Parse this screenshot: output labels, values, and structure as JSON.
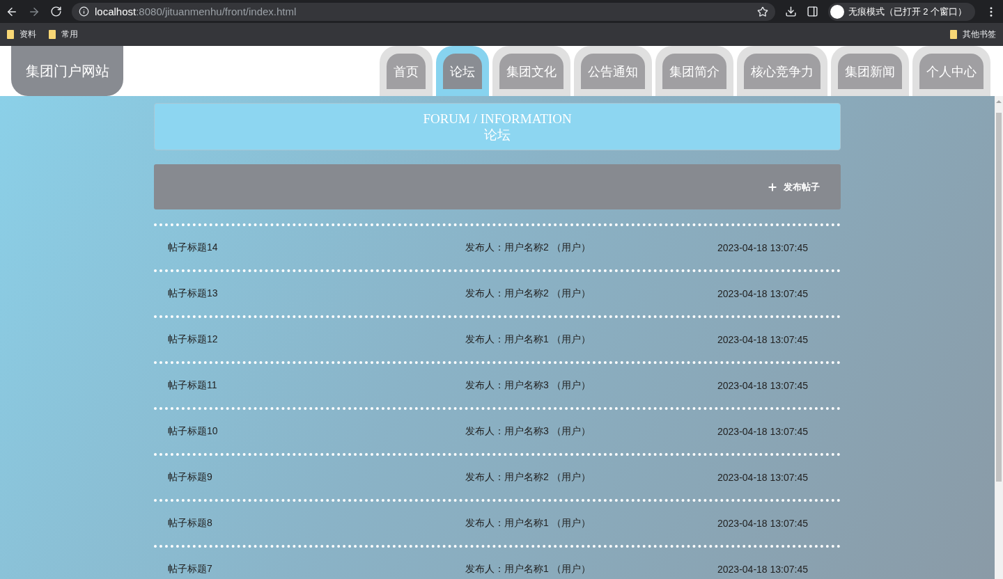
{
  "browser": {
    "url_host": "localhost",
    "url_path": ":8080/jituanmenhu/front/index.html",
    "profile": "无痕模式（已打开 2 个窗口）",
    "bookmarks": [
      "资料",
      "常用"
    ],
    "other_bookmarks": "其他书签"
  },
  "site": {
    "title": "集团门户网站"
  },
  "nav": [
    {
      "label": "首页",
      "selected": false
    },
    {
      "label": "论坛",
      "selected": true
    },
    {
      "label": "集团文化",
      "selected": false
    },
    {
      "label": "公告通知",
      "selected": false
    },
    {
      "label": "集团简介",
      "selected": false
    },
    {
      "label": "核心竞争力",
      "selected": false
    },
    {
      "label": "集团新闻",
      "selected": false
    },
    {
      "label": "个人中心",
      "selected": false
    }
  ],
  "section": {
    "title_en": "FORUM / INFORMATION",
    "title_cn": "论坛"
  },
  "publish_button": "发布帖子",
  "posts": [
    {
      "title": "帖子标题14",
      "author": "发布人：用户名称2 （用户）",
      "time": "2023-04-18 13:07:45"
    },
    {
      "title": "帖子标题13",
      "author": "发布人：用户名称2 （用户）",
      "time": "2023-04-18 13:07:45"
    },
    {
      "title": "帖子标题12",
      "author": "发布人：用户名称1 （用户）",
      "time": "2023-04-18 13:07:45"
    },
    {
      "title": "帖子标题11",
      "author": "发布人：用户名称3 （用户）",
      "time": "2023-04-18 13:07:45"
    },
    {
      "title": "帖子标题10",
      "author": "发布人：用户名称3 （用户）",
      "time": "2023-04-18 13:07:45"
    },
    {
      "title": "帖子标题9",
      "author": "发布人：用户名称2 （用户）",
      "time": "2023-04-18 13:07:45"
    },
    {
      "title": "帖子标题8",
      "author": "发布人：用户名称1 （用户）",
      "time": "2023-04-18 13:07:45"
    },
    {
      "title": "帖子标题7",
      "author": "发布人：用户名称1 （用户）",
      "time": "2023-04-18 13:07:45"
    }
  ]
}
